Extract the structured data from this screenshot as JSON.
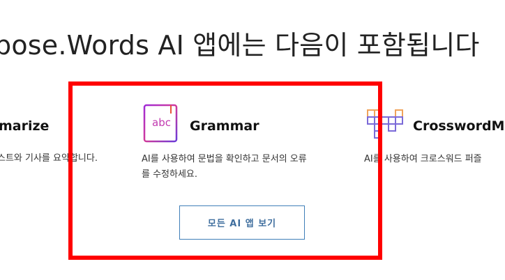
{
  "heading": "pose.Words AI 앱에는 다음이 포함됩니다",
  "cards": [
    {
      "title": "marize",
      "desc_lines": [
        "스트와 기사를 요약합니다."
      ],
      "icon": "summarize-icon"
    },
    {
      "title": "Grammar",
      "desc_lines": [
        "AI를 사용하여 문법을 확인하고 문서의 오류",
        "를 수정하세요."
      ],
      "icon": "abc-book-icon"
    },
    {
      "title": "CrosswordMa",
      "desc_lines": [
        "AI를 사용하여 크로스워드 퍼즐"
      ],
      "icon": "crossword-grid-icon"
    }
  ],
  "view_all_label": "모든 AI 앱 보기",
  "colors": {
    "highlight": "#ff0000",
    "button_border": "#3f7fb8",
    "button_text": "#3f6e9e"
  }
}
